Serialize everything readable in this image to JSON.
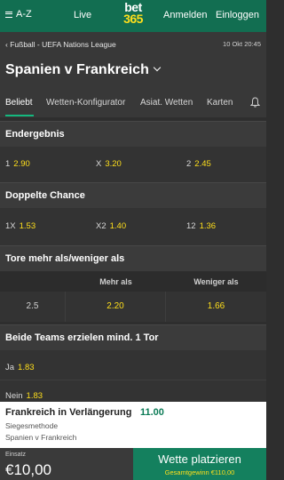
{
  "topbar": {
    "az_label": "A-Z",
    "live_label": "Live",
    "logo_line1": "bet",
    "logo_line2": "365",
    "login_label": "Anmelden",
    "register_label": "Einloggen"
  },
  "header": {
    "breadcrumb": "Fußball - UEFA Nations League",
    "datetime": "10 Okt 20:45",
    "match_title": "Spanien v Frankreich"
  },
  "tabs": [
    "Beliebt",
    "Wetten-Konfigurator",
    "Asiat. Wetten",
    "Karten"
  ],
  "markets": {
    "endergebnis": {
      "title": "Endergebnis",
      "odds": [
        {
          "label": "1",
          "value": "2.90"
        },
        {
          "label": "X",
          "value": "3.20"
        },
        {
          "label": "2",
          "value": "2.45"
        }
      ]
    },
    "doppelte_chance": {
      "title": "Doppelte Chance",
      "odds": [
        {
          "label": "1X",
          "value": "1.53"
        },
        {
          "label": "X2",
          "value": "1.40"
        },
        {
          "label": "12",
          "value": "1.36"
        }
      ]
    },
    "tore": {
      "title": "Tore mehr als/weniger als",
      "col_over": "Mehr als",
      "col_under": "Weniger als",
      "line": "2.5",
      "over": "2.20",
      "under": "1.66"
    },
    "beide_teams": {
      "title": "Beide Teams erzielen mind. 1 Tor",
      "odds": [
        {
          "label": "Ja",
          "value": "1.83"
        },
        {
          "label": "Nein",
          "value": "1.83"
        }
      ]
    }
  },
  "betslip": {
    "selection": "Frankreich in Verlängerung",
    "selection_odds": "11.00",
    "market": "Siegesmethode",
    "event": "Spanien v Frankreich",
    "stake_label": "Einsatz",
    "stake_amount": "€10,00",
    "place_label": "Wette platzieren",
    "total_win": "Gesamtgewinn €110,00"
  },
  "colors": {
    "brand_green": "#126e51",
    "odds_yellow": "#ffdf1b",
    "accent": "#14b87e"
  }
}
